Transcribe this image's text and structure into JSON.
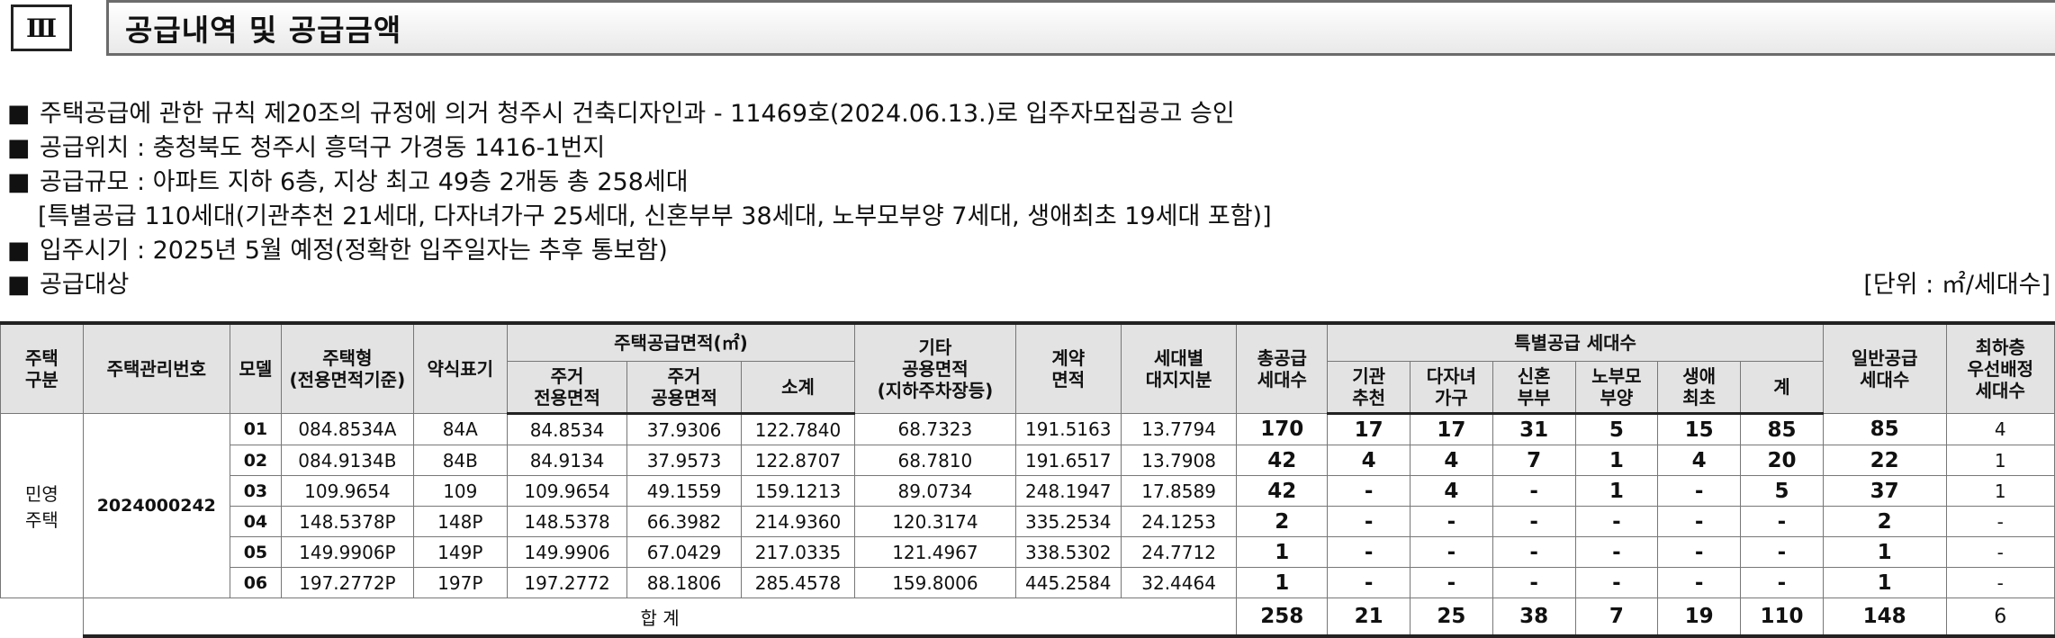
{
  "section": {
    "number": "Ⅲ",
    "title": "공급내역 및 공급금액"
  },
  "bullets": {
    "marker": "■",
    "items": [
      "주택공급에 관한 규칙 제20조의 규정에 의거 청주시 건축디자인과 - 11469호(2024.06.13.)로 입주자모집공고 승인",
      "공급위치 : 충청북도 청주시 흥덕구 가경동 1416-1번지",
      "공급규모 : 아파트 지하 6층, 지상 최고 49층 2개동 총 258세대"
    ],
    "special_note": "[특별공급 110세대(기관추천 21세대, 다자녀가구 25세대, 신혼부부 38세대, 노부모부양 7세대, 생애최초 19세대 포함)]",
    "move_in": "입주시기 : 2025년 5월 예정(정확한 입주일자는 추후 통보함)",
    "target": "공급대상",
    "unit": "[단위 : ㎡/세대수]"
  },
  "table": {
    "headers": {
      "housing_type": "주택\n구분",
      "mgmt_no": "주택관리번호",
      "model": "모델",
      "house_type": "주택형\n(전용면적기준)",
      "short": "약식표기",
      "supply_area": "주택공급면적(㎡)",
      "exclusive": "주거\n전용면적",
      "common": "주거\n공용면적",
      "subtotal": "소계",
      "other_common": "기타\n공용면적\n(지하주차장등)",
      "contract": "계약\n면적",
      "land": "세대별\n대지지분",
      "total_supply": "총공급\n세대수",
      "special": "특별공급 세대수",
      "institution": "기관\n추천",
      "multichild": "다자녀\n가구",
      "newlywed": "신혼\n부부",
      "elderly": "노부모\n부양",
      "firsttime": "생애\n최초",
      "special_total": "계",
      "general": "일반공급\n세대수",
      "lowest_floor": "최하층\n우선배정\n세대수"
    },
    "housing_type_value": "민영\n주택",
    "mgmt_no_value": "2024000242",
    "rows": [
      {
        "model": "01",
        "type": "084.8534A",
        "short": "84A",
        "excl": "84.8534",
        "comm": "37.9306",
        "sub": "122.7840",
        "other": "68.7323",
        "contract": "191.5163",
        "land": "13.7794",
        "total": "170",
        "inst": "17",
        "multi": "17",
        "newly": "31",
        "elder": "5",
        "first": "15",
        "stotal": "85",
        "general": "85",
        "lowest": "4"
      },
      {
        "model": "02",
        "type": "084.9134B",
        "short": "84B",
        "excl": "84.9134",
        "comm": "37.9573",
        "sub": "122.8707",
        "other": "68.7810",
        "contract": "191.6517",
        "land": "13.7908",
        "total": "42",
        "inst": "4",
        "multi": "4",
        "newly": "7",
        "elder": "1",
        "first": "4",
        "stotal": "20",
        "general": "22",
        "lowest": "1"
      },
      {
        "model": "03",
        "type": "109.9654",
        "short": "109",
        "excl": "109.9654",
        "comm": "49.1559",
        "sub": "159.1213",
        "other": "89.0734",
        "contract": "248.1947",
        "land": "17.8589",
        "total": "42",
        "inst": "-",
        "multi": "4",
        "newly": "-",
        "elder": "1",
        "first": "-",
        "stotal": "5",
        "general": "37",
        "lowest": "1"
      },
      {
        "model": "04",
        "type": "148.5378P",
        "short": "148P",
        "excl": "148.5378",
        "comm": "66.3982",
        "sub": "214.9360",
        "other": "120.3174",
        "contract": "335.2534",
        "land": "24.1253",
        "total": "2",
        "inst": "-",
        "multi": "-",
        "newly": "-",
        "elder": "-",
        "first": "-",
        "stotal": "-",
        "general": "2",
        "lowest": "-"
      },
      {
        "model": "05",
        "type": "149.9906P",
        "short": "149P",
        "excl": "149.9906",
        "comm": "67.0429",
        "sub": "217.0335",
        "other": "121.4967",
        "contract": "338.5302",
        "land": "24.7712",
        "total": "1",
        "inst": "-",
        "multi": "-",
        "newly": "-",
        "elder": "-",
        "first": "-",
        "stotal": "-",
        "general": "1",
        "lowest": "-"
      },
      {
        "model": "06",
        "type": "197.2772P",
        "short": "197P",
        "excl": "197.2772",
        "comm": "88.1806",
        "sub": "285.4578",
        "other": "159.8006",
        "contract": "445.2584",
        "land": "32.4464",
        "total": "1",
        "inst": "-",
        "multi": "-",
        "newly": "-",
        "elder": "-",
        "first": "-",
        "stotal": "-",
        "general": "1",
        "lowest": "-"
      }
    ],
    "totals": {
      "label": "합 계",
      "total": "258",
      "inst": "21",
      "multi": "25",
      "newly": "38",
      "elder": "7",
      "first": "19",
      "stotal": "110",
      "general": "148",
      "lowest": "6"
    }
  }
}
